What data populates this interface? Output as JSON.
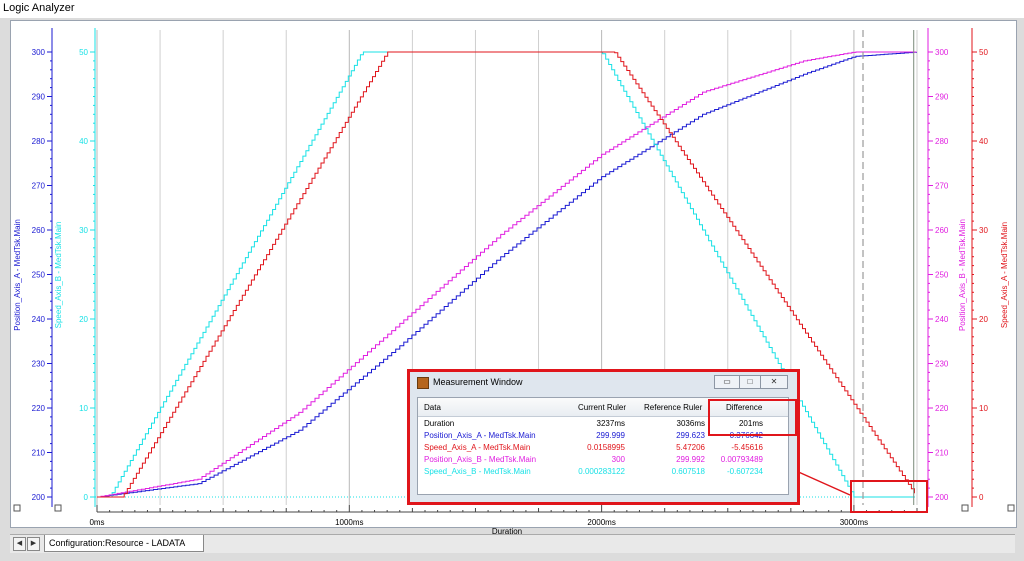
{
  "window": {
    "title": "Logic Analyzer"
  },
  "colors": {
    "position_a": "#1a1ad2",
    "speed_b": "#19e1e6",
    "position_b": "#e01ee0",
    "speed_a": "#e0151b",
    "grid": "#cfcfcf",
    "highlight": "#e0151b"
  },
  "axes": {
    "left_outer_label": "Position_Axis_A - MedTsk.Main",
    "left_inner_label": "Speed_Axis_B - MedTsk.Main",
    "right_inner_label": "Position_Axis_B - MedTsk.Main",
    "right_outer_label": "Speed_Axis_A - MedTsk.Main",
    "position_ticks": [
      "300",
      "290",
      "280",
      "270",
      "260",
      "250",
      "240",
      "230",
      "220",
      "210",
      "200"
    ],
    "speed_ticks": [
      "50",
      "40",
      "30",
      "20",
      "10",
      "0"
    ],
    "x_ticks": [
      "0ms",
      "1000ms",
      "2000ms",
      "3000ms"
    ],
    "x_label": "Duration"
  },
  "chart_data": {
    "type": "line",
    "x_unit": "ms",
    "xlabel": "Duration",
    "xlim": [
      0,
      3250
    ],
    "series": [
      {
        "name": "Position_Axis_A - MedTsk.Main",
        "axis": "position",
        "ylim": [
          200,
          300
        ],
        "x": [
          0,
          400,
          800,
          1200,
          1600,
          2000,
          2400,
          2800,
          3000,
          3250
        ],
        "y": [
          200,
          203,
          215,
          234,
          254,
          272,
          286,
          295,
          299,
          300
        ]
      },
      {
        "name": "Speed_Axis_B - MedTsk.Main",
        "axis": "speed",
        "ylim": [
          0,
          50
        ],
        "x": [
          0,
          50,
          1050,
          2000,
          3000,
          3250
        ],
        "y": [
          0,
          0,
          50,
          50,
          0,
          0
        ]
      },
      {
        "name": "Position_Axis_B - MedTsk.Main",
        "axis": "position",
        "ylim": [
          200,
          300
        ],
        "x": [
          0,
          400,
          800,
          1200,
          1600,
          2000,
          2400,
          2800,
          3000,
          3250
        ],
        "y": [
          200,
          204,
          219,
          239,
          259,
          277,
          291,
          298,
          300,
          300
        ]
      },
      {
        "name": "Speed_Axis_A - MedTsk.Main",
        "axis": "speed",
        "ylim": [
          0,
          50
        ],
        "x": [
          0,
          100,
          1150,
          2050,
          3250
        ],
        "y": [
          0,
          0,
          50,
          50,
          0
        ]
      }
    ],
    "rulers_ms": {
      "reference": 3036,
      "current": 3237
    }
  },
  "measurement": {
    "title": "Measurement Window",
    "buttons": {
      "minimize": "▭",
      "maximize": "□",
      "close": "✕"
    },
    "headers": {
      "data": "Data",
      "current": "Current Ruler",
      "reference": "Reference Ruler",
      "difference": "Difference"
    },
    "rows": [
      {
        "data": "Duration",
        "current": "3237ms",
        "reference": "3036ms",
        "difference": "201ms",
        "color": "#000000"
      },
      {
        "data": "Position_Axis_A - MedTsk.Main",
        "current": "299.999",
        "reference": "299.623",
        "difference": "0.376642",
        "color": "#1a1ad2"
      },
      {
        "data": "Speed_Axis_A - MedTsk.Main",
        "current": "0.0158995",
        "reference": "5.47206",
        "difference": "-5.45616",
        "color": "#e0151b"
      },
      {
        "data": "Position_Axis_B - MedTsk.Main",
        "current": "300",
        "reference": "299.992",
        "difference": "0.00793489",
        "color": "#e01ee0"
      },
      {
        "data": "Speed_Axis_B - MedTsk.Main",
        "current": "0.000283122",
        "reference": "0.607518",
        "difference": "-0.607234",
        "color": "#19e1e6"
      }
    ]
  },
  "tabs": {
    "active": "Configuration:Resource - LADATA",
    "prev": "◀",
    "next": "▶"
  }
}
